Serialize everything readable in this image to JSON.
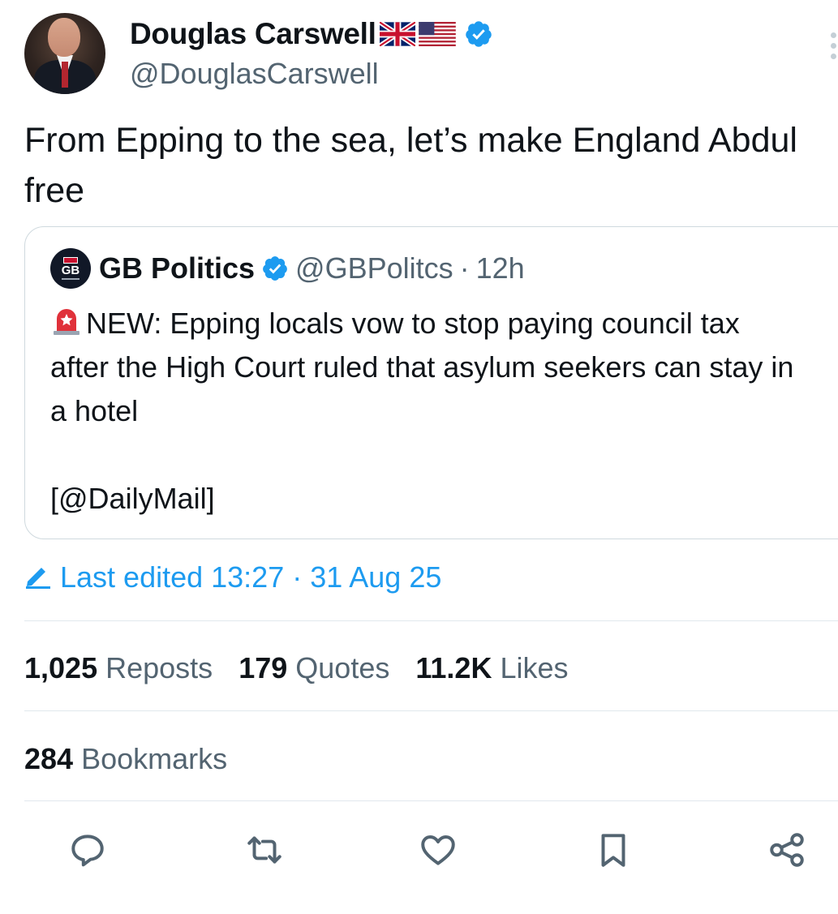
{
  "author": {
    "name": "Douglas Carswell",
    "flags": [
      "uk-flag-icon",
      "us-flag-icon"
    ],
    "handle": "@DouglasCarswell"
  },
  "post": {
    "text": "From Epping to the sea, let’s make England Abdul free"
  },
  "quoted_post": {
    "avatar_text": "GB",
    "name": "GB Politics",
    "handle": "@GBPolitcs",
    "separator": "·",
    "time": "12h",
    "text": "NEW: Epping locals vow to stop paying council tax after the High Court ruled that asylum seekers can stay in a hotel\n\n[@DailyMail]",
    "icon": "siren-icon"
  },
  "edited": {
    "text": "Last edited 13:27 · 31 Aug 25",
    "icon": "pencil-icon"
  },
  "stats": [
    {
      "count": "1,025",
      "label": "Reposts"
    },
    {
      "count": "179",
      "label": "Quotes"
    },
    {
      "count": "11.2K",
      "label": "Likes"
    }
  ],
  "bookmarks": {
    "count": "284",
    "label": "Bookmarks"
  },
  "actions": [
    "reply-icon",
    "repost-icon",
    "like-icon",
    "bookmark-icon",
    "share-icon"
  ],
  "colors": {
    "accent": "#1d9bf0",
    "secondary_text": "#536471",
    "primary_text": "#0f1419",
    "border": "#cfd9de"
  }
}
